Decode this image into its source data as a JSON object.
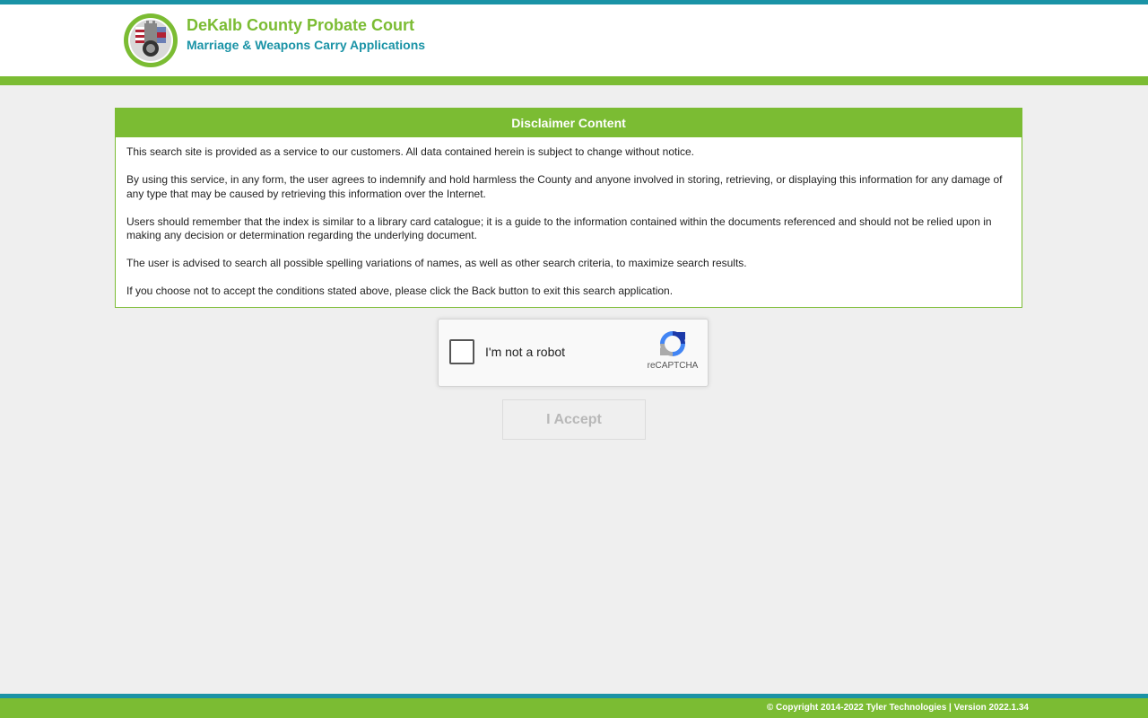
{
  "header": {
    "title": "DeKalb County Probate Court",
    "subtitle": "Marriage & Weapons Carry Applications",
    "logo_icon": "county-seal-icon"
  },
  "disclaimer": {
    "heading": "Disclaimer Content",
    "paragraphs": [
      "This search site is provided as a service to our customers. All data contained herein is subject to change without notice.",
      "By using this service, in any form, the user agrees to indemnify and hold harmless the County and anyone involved in storing, retrieving, or displaying this information for any damage of any type that may be caused by retrieving this information over the Internet.",
      "Users should remember that the index is similar to a library card catalogue; it is a guide to the information contained within the documents referenced and should not be relied upon in making any decision or determination regarding the underlying document.",
      "The user is advised to search all possible spelling variations of names, as well as other search criteria, to maximize search results.",
      "If you choose not to accept the conditions stated above, please click the Back button to exit this search application."
    ]
  },
  "recaptcha": {
    "label": "I'm not a robot",
    "brand": "reCAPTCHA",
    "icon": "recaptcha-icon"
  },
  "actions": {
    "accept_label": "I Accept"
  },
  "footer": {
    "text": "© Copyright 2014-2022 Tyler Technologies | Version 2022.1.34"
  },
  "colors": {
    "brand_green": "#7bbc33",
    "brand_teal": "#1a93a6",
    "background": "#efefef"
  }
}
